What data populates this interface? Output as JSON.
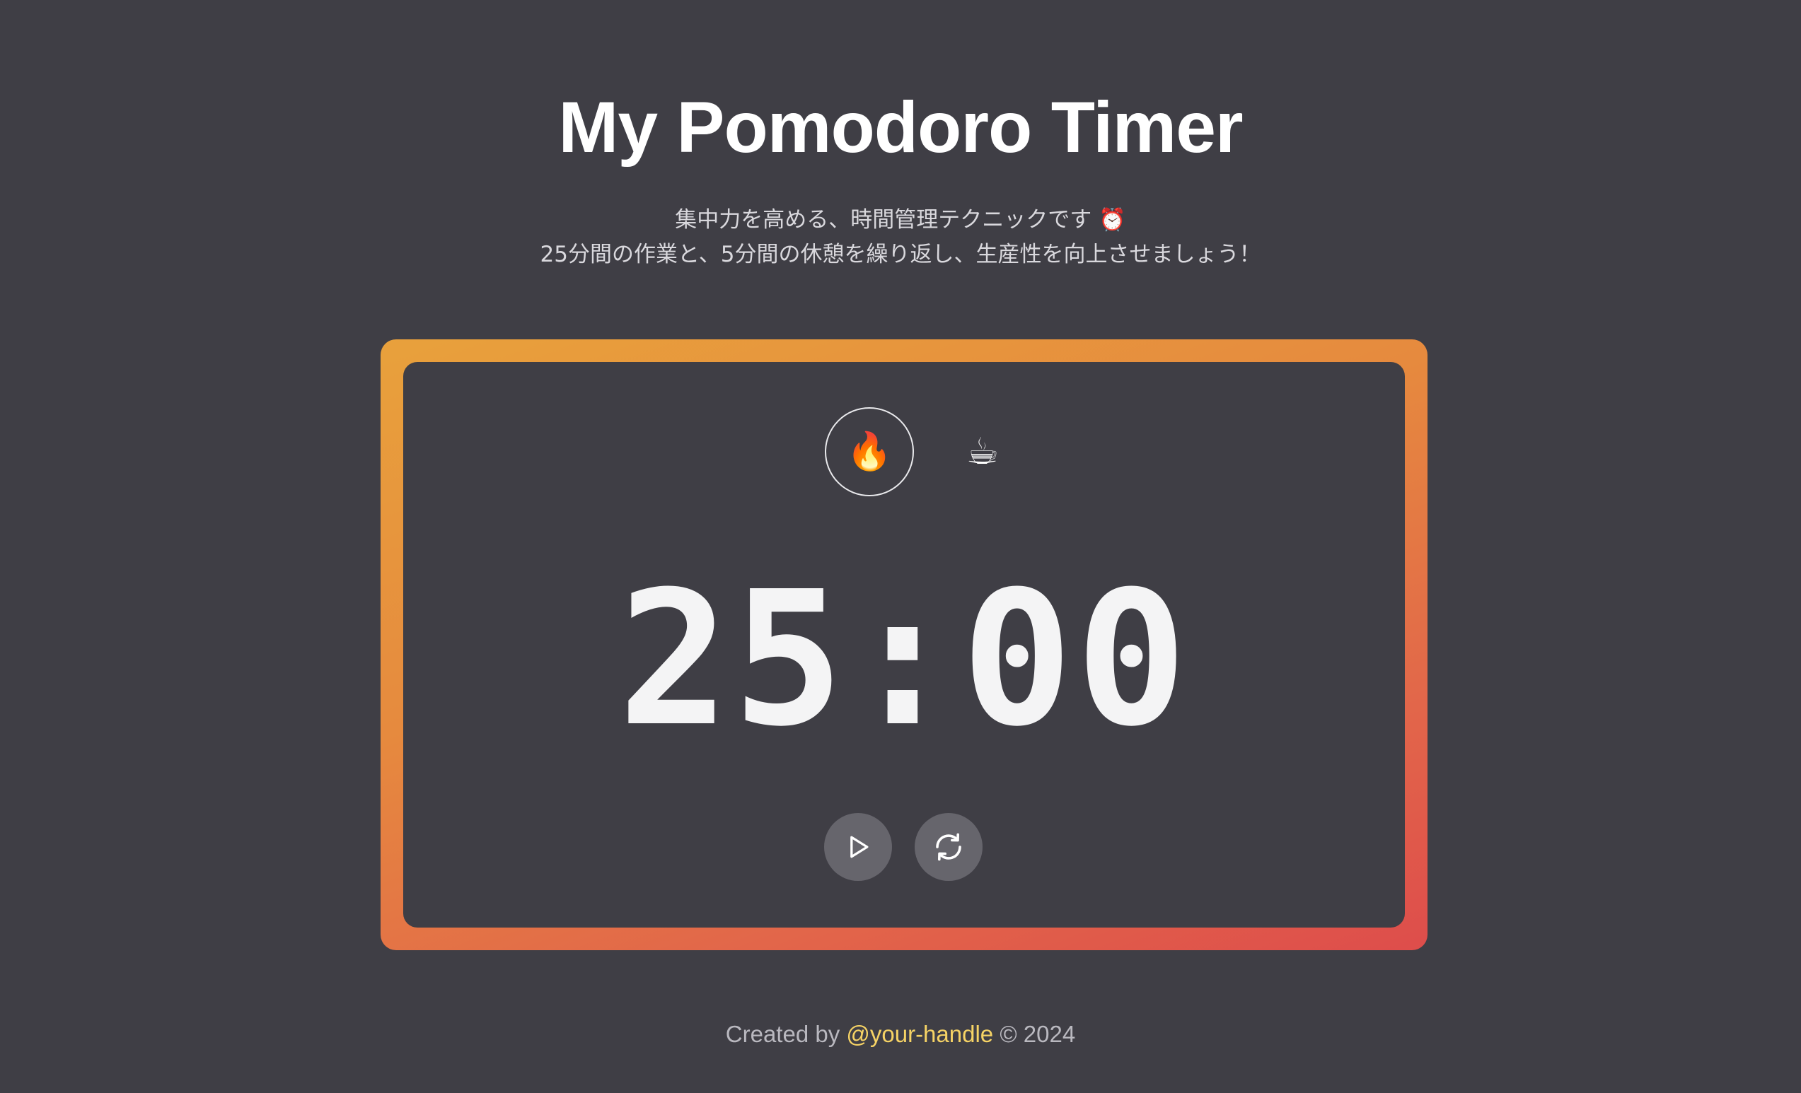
{
  "header": {
    "title": "My Pomodoro Timer",
    "subtitle_line1": "集中力を高める、時間管理テクニックです ⏰",
    "subtitle_line2": "25分間の作業と、5分間の休憩を繰り返し、生産性を向上させましょう！"
  },
  "timer": {
    "modes": [
      {
        "label": "🔥",
        "icon": "fire-icon",
        "selected": true
      },
      {
        "label": "☕",
        "icon": "coffee-icon",
        "selected": false
      }
    ],
    "time_display": "25:00",
    "controls": {
      "play_icon": "play-icon",
      "reset_icon": "reset-icon"
    }
  },
  "footer": {
    "prefix": "Created by",
    "handle": "@your-handle",
    "suffix": "© 2024"
  },
  "colors": {
    "background": "#3f3e45",
    "gradient_start": "#e8a13c",
    "gradient_end": "#de4d4b",
    "link": "#f6d365",
    "button_fill": "#66656c"
  }
}
